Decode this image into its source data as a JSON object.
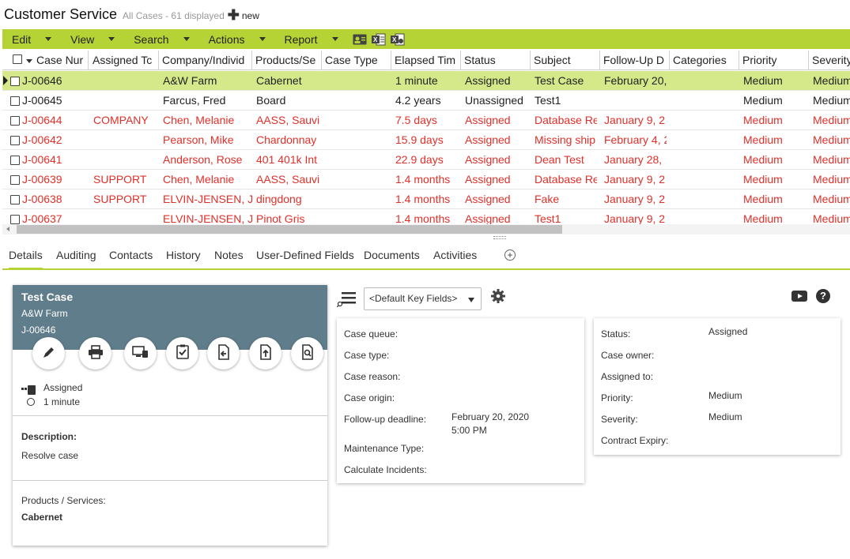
{
  "header": {
    "title": "Customer Service",
    "subtitle": "All Cases - 61 displayed",
    "new_label": "new"
  },
  "toolbar": {
    "items": [
      "Edit",
      "View",
      "Search",
      "Actions",
      "Report"
    ],
    "icons": [
      "contact-card-icon",
      "excel-export-icon",
      "excel-import-icon"
    ],
    "accent_color": "#b5d334"
  },
  "grid": {
    "columns": [
      "Case Nur",
      "Assigned Tc",
      "Company/Individ",
      "Products/Se",
      "Case Type",
      "Elapsed Tim",
      "Status",
      "Subject",
      "Follow-Up D",
      "Categories",
      "Priority",
      "Severity"
    ],
    "rows": [
      {
        "case": "J-00646",
        "assigned": "",
        "company": "A&W Farm",
        "product": "Cabernet",
        "type": "",
        "elapsed": "1 minute",
        "status": "Assigned",
        "subject": "Test Case",
        "followup": "February 20,",
        "categories": "",
        "priority": "Medium",
        "severity": "Medium",
        "style": "black",
        "selected": true
      },
      {
        "case": "J-00645",
        "assigned": "",
        "company": "Farcus, Fred",
        "product": "Board",
        "type": "",
        "elapsed": "4.2 years",
        "status": "Unassigned",
        "subject": "Test1",
        "followup": "",
        "categories": "",
        "priority": "Medium",
        "severity": "Medium",
        "style": "black",
        "selected": false
      },
      {
        "case": "J-00644",
        "assigned": "COMPANY",
        "company": "Chen, Melanie",
        "product": "AASS, Sauvi",
        "type": "",
        "elapsed": "7.5 days",
        "status": "Assigned",
        "subject": "Database Re",
        "followup": "January 9, 2",
        "categories": "",
        "priority": "Medium",
        "severity": "Medium",
        "style": "red",
        "selected": false
      },
      {
        "case": "J-00642",
        "assigned": "",
        "company": "Pearson, Mike",
        "product": "Chardonnay",
        "type": "",
        "elapsed": "15.9 days",
        "status": "Assigned",
        "subject": "Missing ship",
        "followup": "February 4, 2",
        "categories": "",
        "priority": "Medium",
        "severity": "Medium",
        "style": "red",
        "selected": false
      },
      {
        "case": "J-00641",
        "assigned": "",
        "company": "Anderson, Rose",
        "product": "401 401k Int",
        "type": "",
        "elapsed": "22.9 days",
        "status": "Assigned",
        "subject": "Dean Test",
        "followup": "January 28,",
        "categories": "",
        "priority": "Medium",
        "severity": "Medium",
        "style": "red",
        "selected": false
      },
      {
        "case": "J-00639",
        "assigned": "SUPPORT",
        "company": "Chen, Melanie",
        "product": "AASS, Sauvi",
        "type": "",
        "elapsed": "1.4 months",
        "status": "Assigned",
        "subject": "Database Re",
        "followup": "January 9, 2",
        "categories": "",
        "priority": "Medium",
        "severity": "Medium",
        "style": "red",
        "selected": false
      },
      {
        "case": "J-00638",
        "assigned": "SUPPORT",
        "company": "ELVIN-JENSEN, J",
        "product": "dingdong",
        "type": "",
        "elapsed": "1.4 months",
        "status": "Assigned",
        "subject": "Fake",
        "followup": "January 9, 2",
        "categories": "",
        "priority": "Medium",
        "severity": "Medium",
        "style": "red",
        "selected": false
      },
      {
        "case": "J-00637",
        "assigned": "",
        "company": "ELVIN-JENSEN, J",
        "product": "Pinot Gris",
        "type": "",
        "elapsed": "1.4 months",
        "status": "Assigned",
        "subject": "Test1",
        "followup": "January 9, 2",
        "categories": "",
        "priority": "Medium",
        "severity": "Medium",
        "style": "red",
        "selected": false
      }
    ]
  },
  "tabs": [
    "Details",
    "Auditing",
    "Contacts",
    "History",
    "Notes",
    "User-Defined Fields",
    "Documents",
    "Activities"
  ],
  "summary": {
    "title": "Test Case",
    "company": "A&W Farm",
    "case_id": "J-00646",
    "status": "Assigned",
    "elapsed": "1 minute",
    "description_label": "Description:",
    "description": "Resolve case",
    "products_label": "Products / Services:",
    "products": "Cabernet",
    "header_color": "#607d8b",
    "actions": [
      "edit-icon",
      "print-icon",
      "screen-share-icon",
      "checklist-icon",
      "reply-document-icon",
      "upload-icon",
      "search-document-icon"
    ]
  },
  "key_fields_select": "<Default Key Fields>",
  "left_panel": {
    "fields": [
      {
        "label": "Case queue:",
        "value": ""
      },
      {
        "label": "Case type:",
        "value": ""
      },
      {
        "label": "Case reason:",
        "value": ""
      },
      {
        "label": "Case origin:",
        "value": ""
      },
      {
        "label": "Follow-up deadline:",
        "value": "February 20, 2020",
        "value2": "5:00 PM"
      },
      {
        "label": "Maintenance Type:",
        "value": ""
      },
      {
        "label": "Calculate Incidents:",
        "value": ""
      }
    ]
  },
  "right_panel": {
    "fields": [
      {
        "label": "Status:",
        "value": "Assigned"
      },
      {
        "label": "Case owner:",
        "value": ""
      },
      {
        "label": "Assigned to:",
        "value": ""
      },
      {
        "label": "Priority:",
        "value": "Medium"
      },
      {
        "label": "Severity:",
        "value": "Medium"
      },
      {
        "label": "Contract Expiry:",
        "value": ""
      }
    ]
  }
}
